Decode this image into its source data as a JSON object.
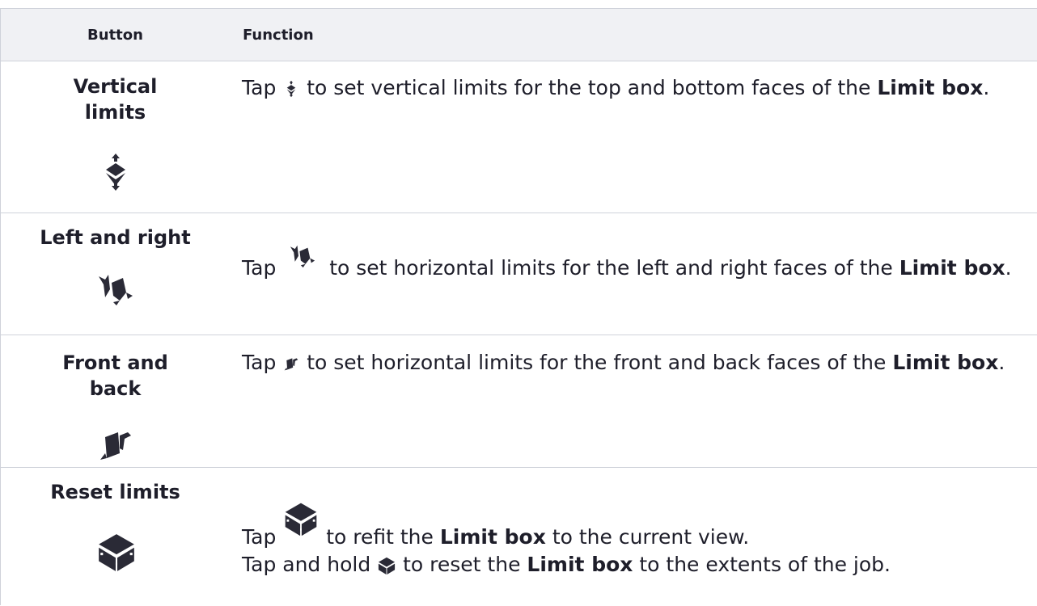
{
  "table": {
    "headers": {
      "button": "Button",
      "function": "Function"
    },
    "rows": [
      {
        "name_line1": "Vertical",
        "name_line2": "limits",
        "icon": "vertical-limits-icon",
        "pre": "Tap",
        "post": "to set vertical limits for the top and bottom faces of the",
        "bold": "Limit box",
        "end": "."
      },
      {
        "name_line1": "Left and right",
        "icon": "left-right-limits-icon",
        "pre": "Tap",
        "post": "to set horizontal limits for the left and right faces of the",
        "bold": "Limit box",
        "end": "."
      },
      {
        "name_line1": "Front and",
        "name_line2": "back",
        "icon": "front-back-limits-icon",
        "pre": "Tap",
        "post": "to set horizontal limits for the front and back faces of the",
        "bold": "Limit box",
        "end": "."
      },
      {
        "name_line1": "Reset limits",
        "icon": "reset-limits-icon",
        "pre": "Tap",
        "post": "to refit the",
        "bold": "Limit box",
        "end": "to the current view.",
        "pre2": "Tap and hold",
        "post2": "to reset the",
        "bold2": "Limit box",
        "end2": "to the extents of the job."
      }
    ]
  }
}
